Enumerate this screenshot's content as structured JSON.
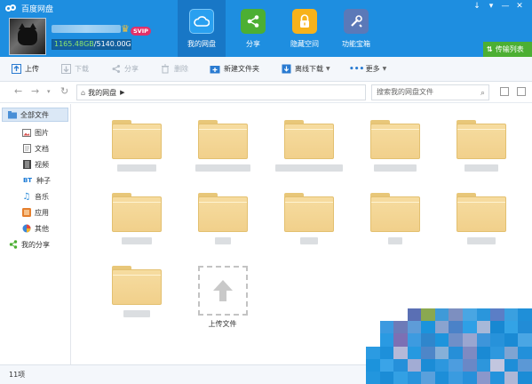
{
  "app": {
    "title": "百度网盘"
  },
  "account": {
    "storage_used": "1165.48GB",
    "storage_total": "/5140.00GB",
    "badge": "SVIP"
  },
  "nav": [
    {
      "label": "我的网盘",
      "icon": "cloud-icon",
      "color": "#29a0f0"
    },
    {
      "label": "分享",
      "icon": "share-icon",
      "color": "#4caf33"
    },
    {
      "label": "隐藏空间",
      "icon": "lock-icon",
      "color": "#f7b21b"
    },
    {
      "label": "功能宝箱",
      "icon": "toolbox-icon",
      "color": "#5b79b8"
    }
  ],
  "window_controls": [
    "↓",
    "▾",
    "—",
    "✕"
  ],
  "transfer_list": "传输列表",
  "toolbar": {
    "upload": "上传",
    "download": "下载",
    "share": "分享",
    "delete": "删除",
    "new_folder": "新建文件夹",
    "offline_download": "离线下载",
    "more": "更多"
  },
  "address": {
    "path": "我的网盘",
    "search_placeholder": "搜索我的网盘文件"
  },
  "sidebar": {
    "all_files": "全部文件",
    "items": [
      {
        "label": "图片",
        "icon": "image-icon"
      },
      {
        "label": "文档",
        "icon": "document-icon"
      },
      {
        "label": "视频",
        "icon": "video-icon"
      },
      {
        "label": "种子",
        "icon": "bt-icon",
        "glyph": "BT"
      },
      {
        "label": "音乐",
        "icon": "music-icon"
      },
      {
        "label": "应用",
        "icon": "app-icon"
      },
      {
        "label": "其他",
        "icon": "other-icon"
      }
    ],
    "my_share": "我的分享"
  },
  "upload_tile_label": "上传文件",
  "status": {
    "item_count": "11项"
  },
  "colors": {
    "header": "#1e8ee0",
    "active_nav": "#1877c6",
    "transfer_green": "#4caf33",
    "folder": "#f3d595"
  }
}
